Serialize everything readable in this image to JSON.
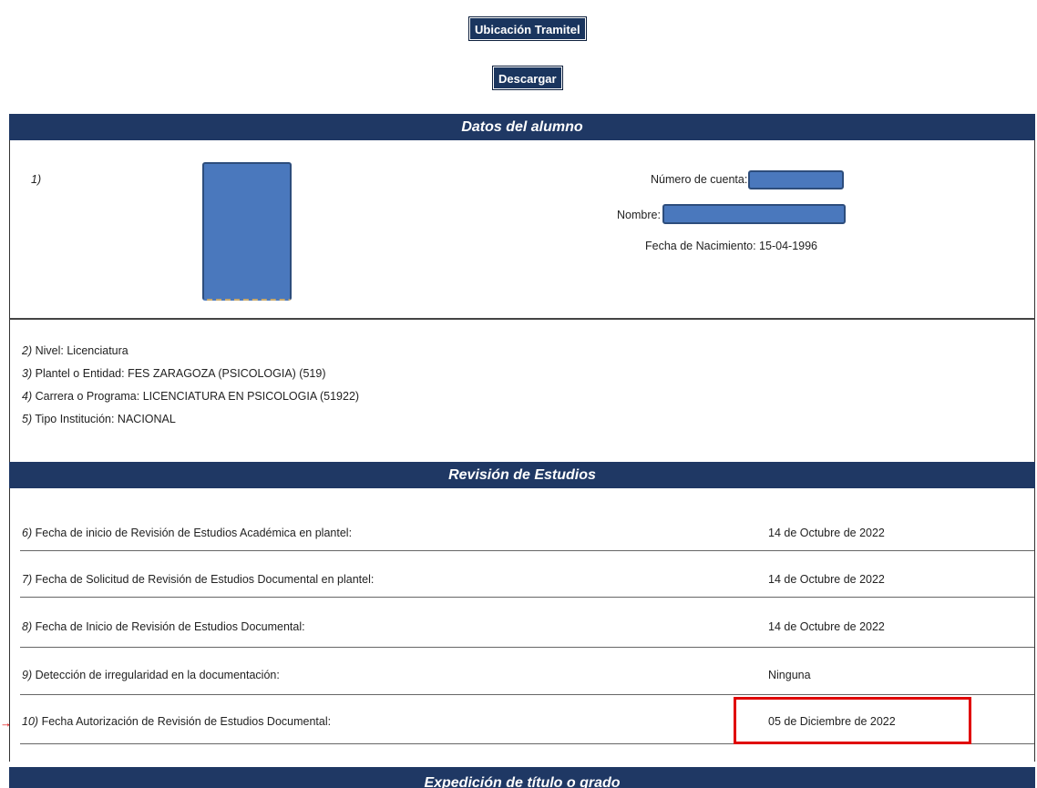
{
  "toolbar": {
    "ubicacion_label": "Ubicación Tramitel",
    "descargar_label": "Descargar"
  },
  "datos_alumno": {
    "header": "Datos del alumno",
    "photo_index": "1)",
    "numero_cuenta_label": "Número de cuenta:",
    "nombre_label": "Nombre:",
    "fecha_nacimiento": "Fecha de Nacimiento: 15-04-1996"
  },
  "info": [
    {
      "num": "2)",
      "text": "Nivel: Licenciatura"
    },
    {
      "num": "3)",
      "text": "Plantel o Entidad: FES ZARAGOZA (PSICOLOGIA) (519)"
    },
    {
      "num": "4)",
      "text": "Carrera o Programa: LICENCIATURA EN PSICOLOGIA (51922)"
    },
    {
      "num": "5)",
      "text": "Tipo Institución: NACIONAL"
    }
  ],
  "revision": {
    "header": "Revisión de Estudios",
    "rows": [
      {
        "num": "6)",
        "label": "Fecha de inicio de Revisión de Estudios Académica en plantel:",
        "value": "14 de Octubre de 2022"
      },
      {
        "num": "7)",
        "label": "Fecha de Solicitud de Revisión de Estudios Documental en plantel:",
        "value": "14 de Octubre de 2022"
      },
      {
        "num": "8)",
        "label": "Fecha de Inicio de Revisión de Estudios Documental:",
        "value": "14 de Octubre de 2022"
      },
      {
        "num": "9)",
        "label": "Detección de irregularidad en la documentación:",
        "value": "Ninguna"
      },
      {
        "num": "10)",
        "label": "Fecha Autorización de Revisión de Estudios Documental:",
        "value": "05 de Diciembre de 2022"
      }
    ]
  },
  "expedicion": {
    "header": "Expedición de título o grado"
  },
  "colors": {
    "header_bg": "#1f3864",
    "redaction": "#4a78bd",
    "highlight": "#e00000"
  }
}
